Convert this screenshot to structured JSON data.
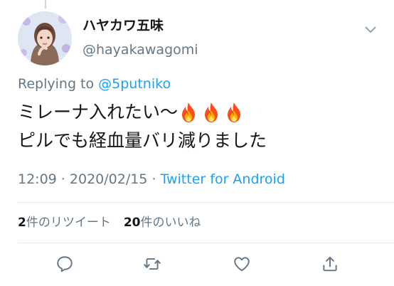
{
  "tweet": {
    "author": {
      "display_name": "ハヤカワ五味",
      "handle": "@hayakawagomi"
    },
    "replying_prefix": "Replying to ",
    "replying_to": "@5putniko",
    "text_line1": "ミレーナ入れたい〜",
    "text_line2": "ピルでも経血量バリ減りました",
    "emoji": [
      "fire-emoji",
      "fire-emoji",
      "fire-emoji"
    ],
    "time": "12:09",
    "separator1": " · ",
    "date": "2020/02/15",
    "separator2": " · ",
    "source": "Twitter for Android",
    "stats": {
      "retweets_count": "2",
      "retweets_label": "件のリツイート",
      "likes_count": "20",
      "likes_label": "件のいいね"
    },
    "actions": [
      "reply-icon",
      "retweet-icon",
      "like-icon",
      "share-icon"
    ]
  },
  "colors": {
    "link": "#1da1f2",
    "secondary_text": "#657786",
    "primary_text": "#14171a",
    "divider": "#e1e8ed"
  }
}
